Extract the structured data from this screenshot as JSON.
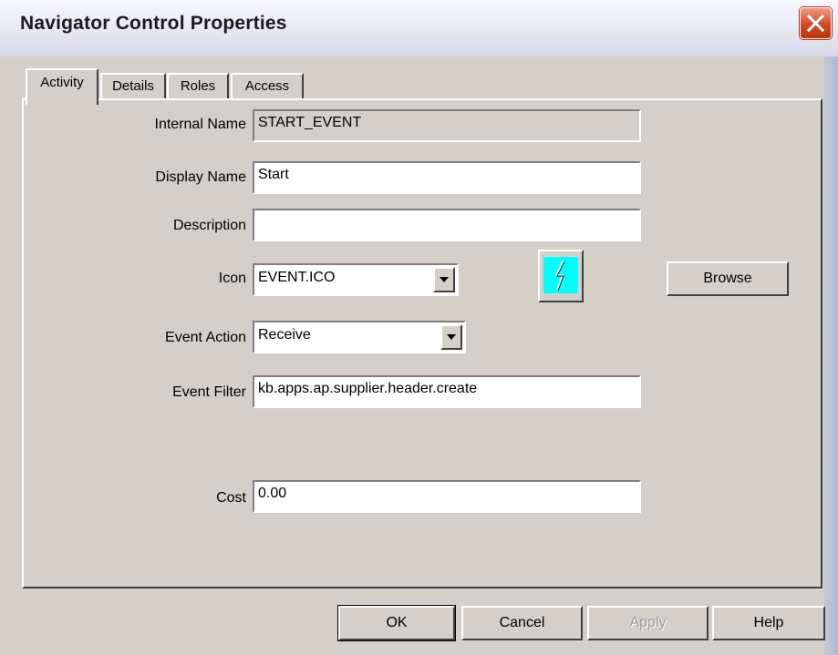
{
  "window": {
    "title": "Navigator Control Properties"
  },
  "tabs": [
    {
      "label": "Activity",
      "active": true
    },
    {
      "label": "Details",
      "active": false
    },
    {
      "label": "Roles",
      "active": false
    },
    {
      "label": "Access",
      "active": false
    }
  ],
  "form": {
    "internal_name": {
      "label": "Internal Name",
      "value": "START_EVENT"
    },
    "display_name": {
      "label": "Display Name",
      "value": "Start"
    },
    "description": {
      "label": "Description",
      "value": ""
    },
    "icon": {
      "label": "Icon",
      "value": "EVENT.ICO",
      "preview_icon": "lightning-icon",
      "preview_color": "#00ffff"
    },
    "event_action": {
      "label": "Event Action",
      "value": "Receive"
    },
    "event_filter": {
      "label": "Event Filter",
      "value": "kb.apps.ap.supplier.header.create"
    },
    "cost": {
      "label": "Cost",
      "value": "0.00"
    },
    "browse_label": "Browse"
  },
  "buttons": {
    "ok": "OK",
    "cancel": "Cancel",
    "apply": "Apply",
    "help": "Help"
  },
  "colors": {
    "close_button": "#d2461e",
    "dialog_face": "#d4d0c8"
  }
}
